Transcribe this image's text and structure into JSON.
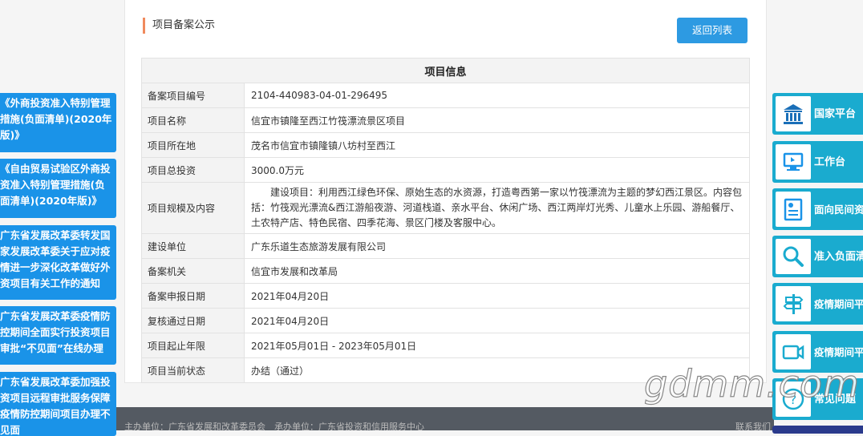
{
  "panel": {
    "title": "项目备案公示",
    "back_label": "返回列表",
    "table_header": "项目信息",
    "rows": [
      {
        "label": "备案项目编号",
        "value": "2104-440983-04-01-296495"
      },
      {
        "label": "项目名称",
        "value": "信宜市镇隆至西江竹筏漂流景区项目"
      },
      {
        "label": "项目所在地",
        "value": "茂名市信宜市镇隆镇八坊村至西江"
      },
      {
        "label": "项目总投资",
        "value": "3000.0万元"
      },
      {
        "label": "项目规模及内容",
        "value": "建设项目：利用西江绿色环保、原始生态的水资源，打造粤西第一家以竹筏漂流为主题的梦幻西江景区。内容包括：竹筏观光漂流&西江游船夜游、河道栈道、亲水平台、休闲广场、西江两岸灯光秀、儿童水上乐园、游船餐厅、土农特产店、特色民宿、四季花海、景区门楼及客服中心。"
      },
      {
        "label": "建设单位",
        "value": "广东乐道生态旅游发展有限公司"
      },
      {
        "label": "备案机关",
        "value": "信宜市发展和改革局"
      },
      {
        "label": "备案申报日期",
        "value": "2021年04月20日"
      },
      {
        "label": "复核通过日期",
        "value": "2021年04月20日"
      },
      {
        "label": "项目起止年限",
        "value": "2021年05月01日 - 2023年05月01日"
      },
      {
        "label": "项目当前状态",
        "value": "办结（通过）"
      }
    ]
  },
  "left_links": [
    "《外商投资准入特别管理措施(负面清单)(2020年版)》",
    "《自由贸易试验区外商投资准入特别管理措施(负面清单)(2020年版)》",
    "广东省发展改革委转发国家发展改革委关于应对疫情进一步深化改革做好外资项目有关工作的通知",
    "广东省发展改革委疫情防控期间全面实行投资项目审批“不见面”在线办理",
    "广东省发展改革委加强投资项目远程审批服务保障疫情防控期间项目办理不见面"
  ],
  "right_nav": [
    {
      "label": "国家平台",
      "icon": "government-building-icon"
    },
    {
      "label": "工作台",
      "icon": "computer-icon"
    },
    {
      "label": "面向民间资本推介项目",
      "icon": "document-icon"
    },
    {
      "label": "准入负面清单查询",
      "icon": "magnifier-icon"
    },
    {
      "label": "疫情期间平台操作指南",
      "icon": "signpost-icon"
    },
    {
      "label": "疫情期间平台操作指引视频",
      "icon": "video-camera-icon"
    },
    {
      "label": "常见问题",
      "icon": "question-icon"
    }
  ],
  "footer": {
    "links": "主办单位：广东省发展和改革委员会　承办单位：广东省投资和信用服务中心",
    "contact": "联系我们"
  },
  "watermark": "gdmm.com",
  "colors": {
    "accent": "#2d9ae2",
    "left_link_bg": "#1a93e8",
    "right_nav_bg": "#1aabcf",
    "title_marker": "#f08a5d"
  }
}
